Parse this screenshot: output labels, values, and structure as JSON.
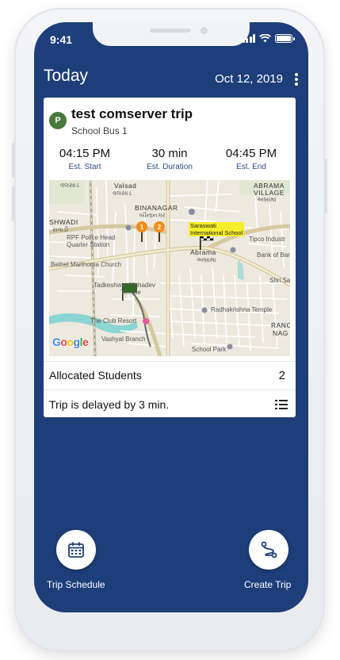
{
  "status_bar": {
    "time": "9:41"
  },
  "header": {
    "title": "Today",
    "date": "Oct 12, 2019"
  },
  "trip": {
    "badge": "P",
    "title": "test comserver trip",
    "subtitle": "School Bus 1",
    "est_start": {
      "value": "04:15 PM",
      "label": "Est. Start"
    },
    "est_duration": {
      "value": "30 min",
      "label": "Est. Duration"
    },
    "est_end": {
      "value": "04:45 PM",
      "label": "Est. End"
    }
  },
  "map": {
    "labels": {
      "valsad": "Valsad",
      "valsad_guj": "વલસાડ",
      "binanagar": "BINANAGAR",
      "binanagar_guj": "બીનાનગર",
      "abrama_village": "ABRAMA",
      "abrama_village2": "VILLAGE",
      "abrama_guj": "અબ્રામા",
      "shwadi": "SHWADI",
      "shwadi_guj": "સવાડી",
      "rpf": "RPF Police Head",
      "rpf2": "Quarter Station",
      "bethel": "Bethel Marthoma Church",
      "tadkeshwar": "Tadkeshwar Mahadev",
      "tadkeshwar2": "Temple",
      "club_resort": "The Club Resort",
      "vashyal": "Vashyal Branch",
      "abrama": "Abrama",
      "abrama2_guj": "અબ્રામા",
      "tipco": "Tipco Industr",
      "bank_baroda": "Bank of Baroda",
      "shri_sa": "Shri Sa",
      "radhakrishna": "Radhakrishna Temple",
      "ranch": "RANCH",
      "nag": "NAG",
      "school_park": "School Park",
      "school_name": "Saraswati",
      "school_name2": "International School",
      "google": "Google"
    },
    "stops": [
      "1",
      "2"
    ]
  },
  "allocated": {
    "label": "Allocated Students",
    "count": "2"
  },
  "delay": {
    "text": "Trip is delayed by 3 min."
  },
  "actions": {
    "schedule_label": "Trip Schedule",
    "create_label": "Create Trip"
  }
}
